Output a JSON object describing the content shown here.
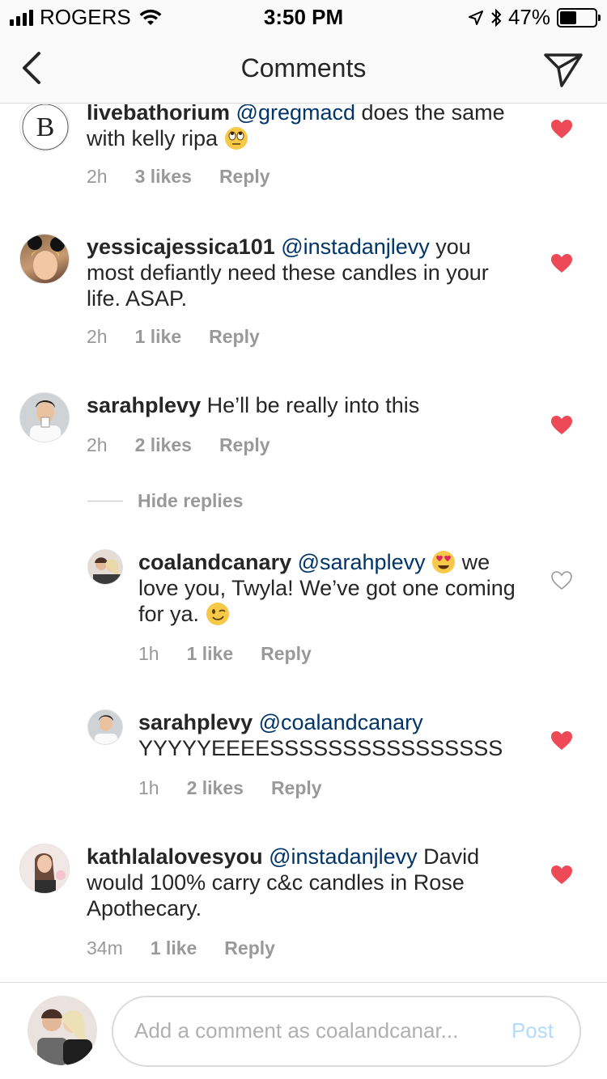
{
  "status_bar": {
    "carrier": "ROGERS",
    "time": "3:50 PM",
    "battery": "47%",
    "battery_level": 0.47
  },
  "nav": {
    "title": "Comments",
    "back_icon": "chevron-left-icon",
    "send_icon": "paper-plane-icon"
  },
  "comments": [
    {
      "username": "livebathorium",
      "mention": "@gregmacd",
      "text": " does the same with kelly ripa",
      "emoji": "rolling-eyes-emoji",
      "time": "2h",
      "likes": "3 likes",
      "reply": "Reply",
      "liked": true
    },
    {
      "username": "yessicajessica101",
      "mention": "@instadanjlevy",
      "text": "  you most defiantly need these candles in your life. ASAP.",
      "time": "2h",
      "likes": "1 like",
      "reply": "Reply",
      "liked": true
    },
    {
      "username": "sarahplevy",
      "text": " He’ll be really into this",
      "time": "2h",
      "likes": "2 likes",
      "reply": "Reply",
      "liked": true
    },
    {
      "username": "coalandcanary",
      "mention": "@sarahplevy",
      "text_a": " we love you, Twyla! We’ve got one coming for ya.",
      "emoji_a": "heart-eyes-emoji",
      "emoji_b": "winking-face-emoji",
      "time": "1h",
      "likes": "1 like",
      "reply": "Reply",
      "liked": false
    },
    {
      "username": "sarahplevy",
      "mention": "@coalandcanary",
      "text": " YYYYYEEEESSSSSSSSSSSSSSSS",
      "time": "1h",
      "likes": "2 likes",
      "reply": "Reply",
      "liked": true
    },
    {
      "username": "kathlalalovesyou",
      "mention": "@instadanjlevy",
      "text": " David would 100% carry c&c candles in Rose Apothecary.",
      "time": "34m",
      "likes": "1 like",
      "reply": "Reply",
      "liked": true
    }
  ],
  "hide_replies": "Hide replies",
  "composer": {
    "placeholder": "Add a comment as coalandcanar...",
    "post": "Post"
  },
  "colors": {
    "heart_red": "#ed4956",
    "mention_blue": "#003569",
    "meta_gray": "#999999",
    "post_disabled": "#b3dbff"
  }
}
